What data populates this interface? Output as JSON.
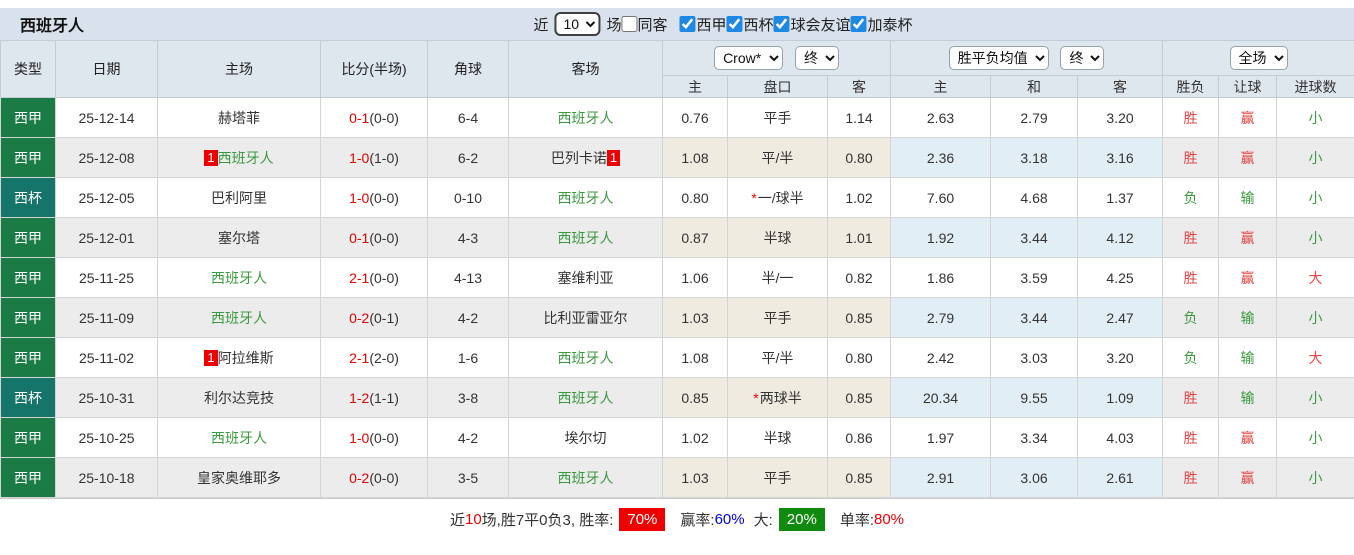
{
  "topbar": {
    "title": "西班牙人",
    "near_label": "近",
    "near_value": "10",
    "matches_label": "场",
    "same_away_label": "同客",
    "same_away_checked": false,
    "leagues": [
      {
        "label": "西甲",
        "checked": true
      },
      {
        "label": "西杯",
        "checked": true
      },
      {
        "label": "球会友谊",
        "checked": true
      },
      {
        "label": "加泰杯",
        "checked": true
      }
    ]
  },
  "table": {
    "cols": [
      "类型",
      "日期",
      "主场",
      "比分(半场)",
      "角球",
      "客场"
    ],
    "selectors": {
      "bookmaker": "Crow*",
      "bookmaker_time": "终",
      "avg": "胜平负均值",
      "avg_time": "终",
      "scope": "全场"
    },
    "sub": [
      "主",
      "盘口",
      "客",
      "主",
      "和",
      "客",
      "胜负",
      "让球",
      "进球数"
    ]
  },
  "rows": [
    {
      "type": "西甲",
      "date": "25-12-14",
      "home": "赫塔菲",
      "home_badge": "",
      "score_ft": "0-1",
      "score_ht": "(0-0)",
      "corner": "6-4",
      "away": "西班牙人",
      "away_badge": "",
      "crown_home": "0.76",
      "handicap_star": "",
      "handicap": "平手",
      "crown_away": "1.14",
      "avg_home": "2.63",
      "avg_draw": "2.79",
      "avg_away": "3.20",
      "result": "胜",
      "handicap_result": "赢",
      "goals_result": "小"
    },
    {
      "type": "西甲",
      "date": "25-12-08",
      "home": "西班牙人",
      "home_badge": "1",
      "score_ft": "1-0",
      "score_ht": "(1-0)",
      "corner": "6-2",
      "away": "巴列卡诺",
      "away_badge": "1",
      "crown_home": "1.08",
      "handicap_star": "",
      "handicap": "平/半",
      "crown_away": "0.80",
      "avg_home": "2.36",
      "avg_draw": "3.18",
      "avg_away": "3.16",
      "result": "胜",
      "handicap_result": "赢",
      "goals_result": "小"
    },
    {
      "type": "西杯",
      "date": "25-12-05",
      "home": "巴利阿里",
      "home_badge": "",
      "score_ft": "1-0",
      "score_ht": "(0-0)",
      "corner": "0-10",
      "away": "西班牙人",
      "away_badge": "",
      "crown_home": "0.80",
      "handicap_star": "*",
      "handicap": "一/球半",
      "crown_away": "1.02",
      "avg_home": "7.60",
      "avg_draw": "4.68",
      "avg_away": "1.37",
      "result": "负",
      "handicap_result": "输",
      "goals_result": "小"
    },
    {
      "type": "西甲",
      "date": "25-12-01",
      "home": "塞尔塔",
      "home_badge": "",
      "score_ft": "0-1",
      "score_ht": "(0-0)",
      "corner": "4-3",
      "away": "西班牙人",
      "away_badge": "",
      "crown_home": "0.87",
      "handicap_star": "",
      "handicap": "半球",
      "crown_away": "1.01",
      "avg_home": "1.92",
      "avg_draw": "3.44",
      "avg_away": "4.12",
      "result": "胜",
      "handicap_result": "赢",
      "goals_result": "小"
    },
    {
      "type": "西甲",
      "date": "25-11-25",
      "home": "西班牙人",
      "home_badge": "",
      "score_ft": "2-1",
      "score_ht": "(0-0)",
      "corner": "4-13",
      "away": "塞维利亚",
      "away_badge": "",
      "crown_home": "1.06",
      "handicap_star": "",
      "handicap": "半/一",
      "crown_away": "0.82",
      "avg_home": "1.86",
      "avg_draw": "3.59",
      "avg_away": "4.25",
      "result": "胜",
      "handicap_result": "赢",
      "goals_result": "大"
    },
    {
      "type": "西甲",
      "date": "25-11-09",
      "home": "西班牙人",
      "home_badge": "",
      "score_ft": "0-2",
      "score_ht": "(0-1)",
      "corner": "4-2",
      "away": "比利亚雷亚尔",
      "away_badge": "",
      "crown_home": "1.03",
      "handicap_star": "",
      "handicap": "平手",
      "crown_away": "0.85",
      "avg_home": "2.79",
      "avg_draw": "3.44",
      "avg_away": "2.47",
      "result": "负",
      "handicap_result": "输",
      "goals_result": "小"
    },
    {
      "type": "西甲",
      "date": "25-11-02",
      "home": "阿拉维斯",
      "home_badge": "1",
      "score_ft": "2-1",
      "score_ht": "(2-0)",
      "corner": "1-6",
      "away": "西班牙人",
      "away_badge": "",
      "crown_home": "1.08",
      "handicap_star": "",
      "handicap": "平/半",
      "crown_away": "0.80",
      "avg_home": "2.42",
      "avg_draw": "3.03",
      "avg_away": "3.20",
      "result": "负",
      "handicap_result": "输",
      "goals_result": "大"
    },
    {
      "type": "西杯",
      "date": "25-10-31",
      "home": "利尔达竞技",
      "home_badge": "",
      "score_ft": "1-2",
      "score_ht": "(1-1)",
      "corner": "3-8",
      "away": "西班牙人",
      "away_badge": "",
      "crown_home": "0.85",
      "handicap_star": "*",
      "handicap": "两球半",
      "crown_away": "0.85",
      "avg_home": "20.34",
      "avg_draw": "9.55",
      "avg_away": "1.09",
      "result": "胜",
      "handicap_result": "输",
      "goals_result": "小"
    },
    {
      "type": "西甲",
      "date": "25-10-25",
      "home": "西班牙人",
      "home_badge": "",
      "score_ft": "1-0",
      "score_ht": "(0-0)",
      "corner": "4-2",
      "away": "埃尔切",
      "away_badge": "",
      "crown_home": "1.02",
      "handicap_star": "",
      "handicap": "半球",
      "crown_away": "0.86",
      "avg_home": "1.97",
      "avg_draw": "3.34",
      "avg_away": "4.03",
      "result": "胜",
      "handicap_result": "赢",
      "goals_result": "小"
    },
    {
      "type": "西甲",
      "date": "25-10-18",
      "home": "皇家奥维耶多",
      "home_badge": "",
      "score_ft": "0-2",
      "score_ht": "(0-0)",
      "corner": "3-5",
      "away": "西班牙人",
      "away_badge": "",
      "crown_home": "1.03",
      "handicap_star": "",
      "handicap": "平手",
      "crown_away": "0.85",
      "avg_home": "2.91",
      "avg_draw": "3.06",
      "avg_away": "2.61",
      "result": "胜",
      "handicap_result": "赢",
      "goals_result": "小"
    }
  ],
  "footer": {
    "near_label": "近",
    "count": "10",
    "summary": "场,胜7平0负3, 胜率:",
    "win_rate": "70%",
    "win_odds_label": "赢率:",
    "win_odds_rate": "60%",
    "big_label": "大:",
    "big_rate": "20%",
    "single_label": "单率:",
    "single_rate": "80%"
  },
  "colors": {
    "liga_badge": "#1a7b44",
    "cup_badge": "#15756b",
    "self_team_green": "#3a9a3f",
    "score_red": "#e60000",
    "win_red": "#e64545",
    "loss_green": "#3a9a3f",
    "rate_red": "#ee0000",
    "rate_green": "#0f8a0f",
    "rate_blue": "#0000ee",
    "header_bg": "#dee6ee",
    "topbar_bg": "#d9e2ec"
  }
}
